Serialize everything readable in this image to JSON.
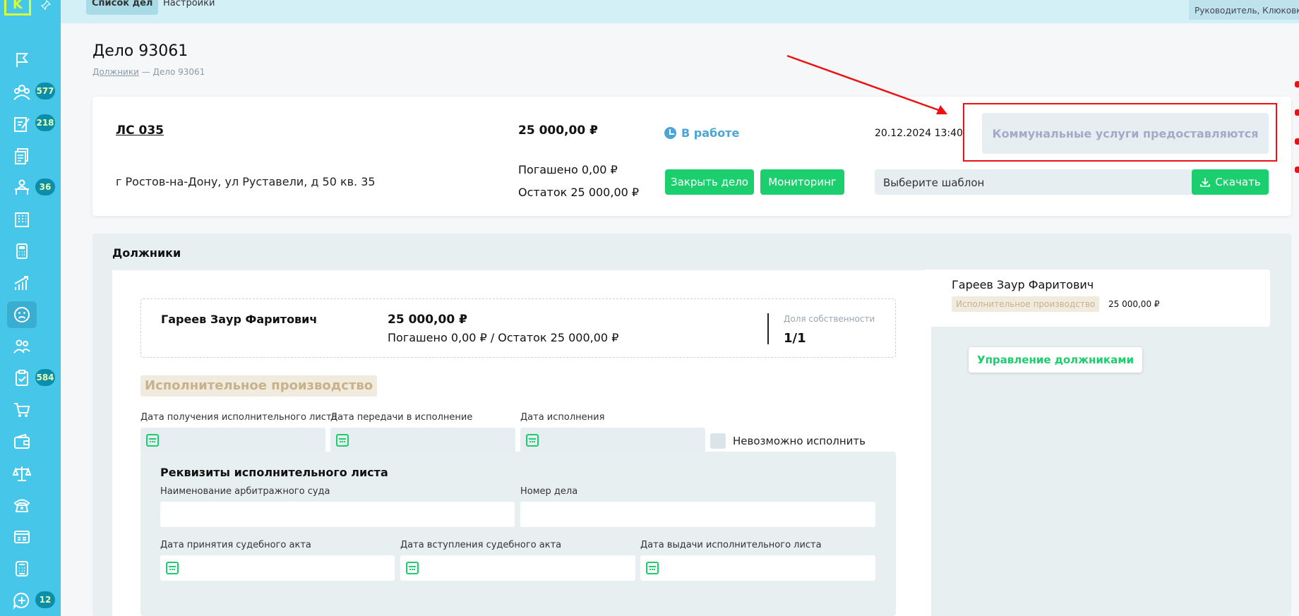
{
  "topbar": {
    "tabs": [
      {
        "label": "Список дел"
      },
      {
        "label": "Настройки"
      }
    ],
    "user": "Руководитель, Клюковка"
  },
  "sidebar": {
    "logo": "K",
    "items": [
      {
        "icon": "flag-icon"
      },
      {
        "icon": "users-group-icon",
        "badge": "577"
      },
      {
        "icon": "edit-note-icon",
        "badge": "218"
      },
      {
        "icon": "documents-icon"
      },
      {
        "icon": "person-desk-icon",
        "badge": "36"
      },
      {
        "icon": "building-icon"
      },
      {
        "icon": "calculator-icon"
      },
      {
        "icon": "chart-growth-icon"
      },
      {
        "icon": "sad-face-icon"
      },
      {
        "icon": "team-icon"
      },
      {
        "icon": "clipboard-check-icon",
        "badge": "584"
      },
      {
        "icon": "cart-icon"
      },
      {
        "icon": "wallet-icon"
      },
      {
        "icon": "scales-icon"
      },
      {
        "icon": "phone-icon"
      },
      {
        "icon": "card-list-icon"
      },
      {
        "icon": "calculator-grid-icon"
      },
      {
        "icon": "chat-add-icon",
        "badge": "12"
      }
    ]
  },
  "page": {
    "title": "Дело 93061",
    "breadcrumb": {
      "link": "Должники",
      "sep": " — ",
      "current": "Дело 93061"
    }
  },
  "case": {
    "account": "ЛС 035",
    "address": "г Ростов-на-Дону, ул Руставели, д 50 кв. 35",
    "amount": "25 000,00 ₽",
    "paid": "Погашено 0,00 ₽",
    "remain": "Остаток 25 000,00 ₽",
    "status": "В работе",
    "close_btn": "Закрыть дело",
    "monitor_btn": "Мониторинг",
    "datetime": "20.12.2024 13:40",
    "service_status": "Коммунальные услуги предоставляются",
    "template_select": "Выберите шаблон",
    "download_btn": "Скачать"
  },
  "debtors": {
    "title": "Должники",
    "card": {
      "name": "Гареев Заур Фаритович",
      "amount": "25 000,00 ₽",
      "sub": "Погашено 0,00 ₽ / Остаток 25 000,00 ₽",
      "share_label": "Доля собственности",
      "share": "1/1"
    },
    "ep_badge": "Исполнительное производство",
    "fields": {
      "receive_date": "Дата получения исполнительного листа",
      "transfer_date": "Дата передачи в исполнение",
      "exec_date": "Дата исполнения",
      "impossible": "Невозможно исполнить"
    },
    "requisites": {
      "title": "Реквизиты исполнительного листа",
      "court_name": "Наименование арбитражного суда",
      "case_number": "Номер дела",
      "act_date": "Дата принятия судебного акта",
      "act_effective": "Дата вступления судебного акта",
      "issue_date": "Дата выдачи исполнительного листа"
    },
    "right": {
      "name": "Гареев Заур Фаритович",
      "badge": "Исполнительное производство",
      "amount": "25 000,00 ₽",
      "manage_btn": "Управление должниками"
    }
  },
  "colors": {
    "sidebar": "#46c6e8",
    "accent_green": "#1ccf6e",
    "annotation_red": "#e11111",
    "status_blue": "#4aa6d6"
  }
}
